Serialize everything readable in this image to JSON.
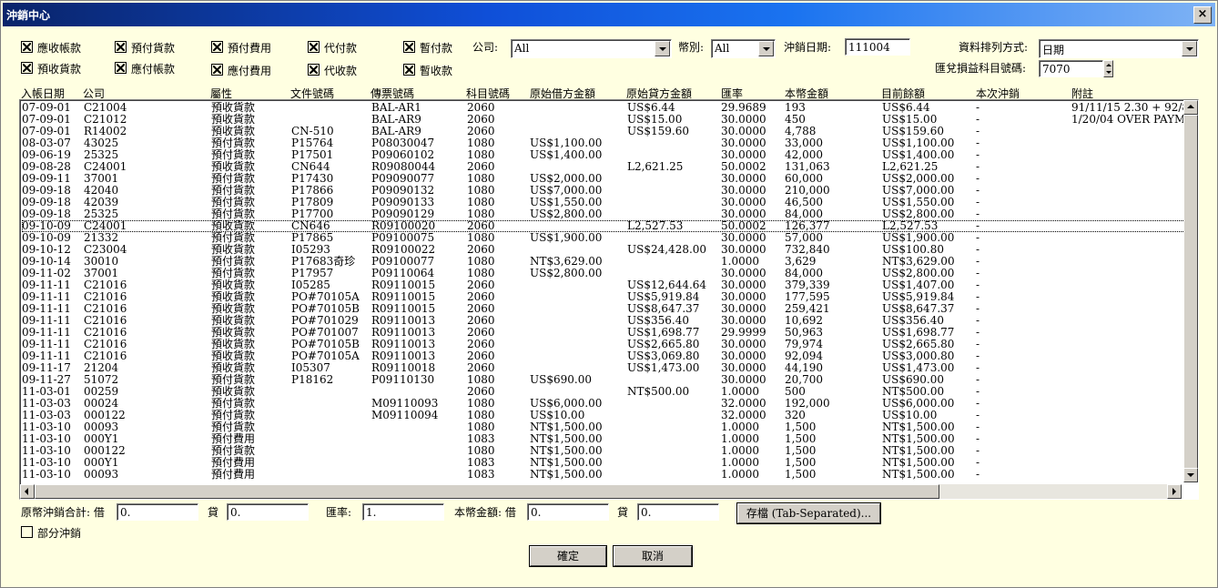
{
  "window": {
    "title": "沖銷中心",
    "close_label": "×"
  },
  "filters": {
    "checkboxes": [
      {
        "label": "應收帳款",
        "checked": true
      },
      {
        "label": "預付貨款",
        "checked": true
      },
      {
        "label": "預付費用",
        "checked": true
      },
      {
        "label": "代付款",
        "checked": true
      },
      {
        "label": "暫付款",
        "checked": true
      },
      {
        "label": "預收貨款",
        "checked": true
      },
      {
        "label": "應付帳款",
        "checked": true
      },
      {
        "label": "應付費用",
        "checked": true
      },
      {
        "label": "代收款",
        "checked": true
      },
      {
        "label": "暫收款",
        "checked": true
      }
    ],
    "company_label": "公司:",
    "company_value": "All",
    "currency_label": "幣別:",
    "currency_value": "All",
    "date_label": "沖銷日期:",
    "date_value": "111004",
    "sort_label": "資料排列方式:",
    "sort_value": "日期",
    "fx_account_label": "匯兌損益科目號碼:",
    "fx_account_value": "7070"
  },
  "table": {
    "columns": [
      "入帳日期",
      "公司",
      "屬性",
      "文件號碼",
      "傳票號碼",
      "科目號碼",
      "原始借方金額",
      "原始貸方金額",
      "匯率",
      "本幣金額",
      "目前餘額",
      "本次沖銷",
      "附註"
    ],
    "rows": [
      [
        "07-09-01",
        "C21004",
        "預收貨款",
        "",
        "BAL-AR1",
        "2060",
        "",
        "US$6.44",
        "29.9689",
        "193",
        "US$6.44",
        "-",
        "91/11/15 2.30 + 92/8/20 C"
      ],
      [
        "07-09-01",
        "C21012",
        "預收貨款",
        "",
        "BAL-AR9",
        "2060",
        "",
        "US$15.00",
        "30.0000",
        "450",
        "US$15.00",
        "-",
        "1/20/04 OVER PAYMEN"
      ],
      [
        "07-09-01",
        "R14002",
        "預收貨款",
        "CN-510",
        "BAL-AR9",
        "2060",
        "",
        "US$159.60",
        "30.0000",
        "4,788",
        "US$159.60",
        "-",
        ""
      ],
      [
        "08-03-07",
        "43025",
        "預付貨款",
        "P15764",
        "P08030047",
        "1080",
        "US$1,100.00",
        "",
        "30.0000",
        "33,000",
        "US$1,100.00",
        "-",
        ""
      ],
      [
        "09-06-19",
        "25325",
        "預付貨款",
        "P17501",
        "P09060102",
        "1080",
        "US$1,400.00",
        "",
        "30.0000",
        "42,000",
        "US$1,400.00",
        "-",
        ""
      ],
      [
        "09-08-28",
        "C24001",
        "預收貨款",
        "CN644",
        "R09080044",
        "2060",
        "",
        "L2,621.25",
        "50.0002",
        "131,063",
        "L2,621.25",
        "-",
        ""
      ],
      [
        "09-09-11",
        "37001",
        "預付貨款",
        "P17430",
        "P09090077",
        "1080",
        "US$2,000.00",
        "",
        "30.0000",
        "60,000",
        "US$2,000.00",
        "-",
        ""
      ],
      [
        "09-09-18",
        "42040",
        "預付貨款",
        "P17866",
        "P09090132",
        "1080",
        "US$7,000.00",
        "",
        "30.0000",
        "210,000",
        "US$7,000.00",
        "-",
        ""
      ],
      [
        "09-09-18",
        "42039",
        "預付貨款",
        "P17809",
        "P09090133",
        "1080",
        "US$1,550.00",
        "",
        "30.0000",
        "46,500",
        "US$1,550.00",
        "-",
        ""
      ],
      [
        "09-09-18",
        "25325",
        "預付貨款",
        "P17700",
        "P09090129",
        "1080",
        "US$2,800.00",
        "",
        "30.0000",
        "84,000",
        "US$2,800.00",
        "-",
        ""
      ],
      [
        "09-10-09",
        "C24001",
        "預收貨款",
        "CN646",
        "R09100020",
        "2060",
        "",
        "L2,527.53",
        "50.0002",
        "126,377",
        "L2,527.53",
        "-",
        ""
      ],
      [
        "09-10-09",
        "21332",
        "預付貨款",
        "P17865",
        "P09100075",
        "1080",
        "US$1,900.00",
        "",
        "30.0000",
        "57,000",
        "US$1,900.00",
        "-",
        ""
      ],
      [
        "09-10-12",
        "C23004",
        "預收貨款",
        "I05293",
        "R09100022",
        "2060",
        "",
        "US$24,428.00",
        "30.0000",
        "732,840",
        "US$100.80",
        "-",
        ""
      ],
      [
        "09-10-14",
        "30010",
        "預付貨款",
        "P17683奇珍",
        "P09100077",
        "1080",
        "NT$3,629.00",
        "",
        "1.0000",
        "3,629",
        "NT$3,629.00",
        "-",
        ""
      ],
      [
        "09-11-02",
        "37001",
        "預付貨款",
        "P17957",
        "P09110064",
        "1080",
        "US$2,800.00",
        "",
        "30.0000",
        "84,000",
        "US$2,800.00",
        "-",
        ""
      ],
      [
        "09-11-11",
        "C21016",
        "預收貨款",
        "I05285",
        "R09110015",
        "2060",
        "",
        "US$12,644.64",
        "30.0000",
        "379,339",
        "US$1,407.00",
        "-",
        ""
      ],
      [
        "09-11-11",
        "C21016",
        "預收貨款",
        "PO#70105A",
        "R09110015",
        "2060",
        "",
        "US$5,919.84",
        "30.0000",
        "177,595",
        "US$5,919.84",
        "-",
        ""
      ],
      [
        "09-11-11",
        "C21016",
        "預收貨款",
        "PO#70105B",
        "R09110015",
        "2060",
        "",
        "US$8,647.37",
        "30.0000",
        "259,421",
        "US$8,647.37",
        "-",
        ""
      ],
      [
        "09-11-11",
        "C21016",
        "預收貨款",
        "PO#701029",
        "R09110013",
        "2060",
        "",
        "US$356.40",
        "30.0000",
        "10,692",
        "US$356.40",
        "-",
        ""
      ],
      [
        "09-11-11",
        "C21016",
        "預收貨款",
        "PO#701007",
        "R09110013",
        "2060",
        "",
        "US$1,698.77",
        "29.9999",
        "50,963",
        "US$1,698.77",
        "-",
        ""
      ],
      [
        "09-11-11",
        "C21016",
        "預收貨款",
        "PO#70105B",
        "R09110013",
        "2060",
        "",
        "US$2,665.80",
        "30.0000",
        "79,974",
        "US$2,665.80",
        "-",
        ""
      ],
      [
        "09-11-11",
        "C21016",
        "預收貨款",
        "PO#70105A",
        "R09110013",
        "2060",
        "",
        "US$3,069.80",
        "30.0000",
        "92,094",
        "US$3,000.80",
        "-",
        ""
      ],
      [
        "09-11-17",
        "21204",
        "預收貨款",
        "I05307",
        "R09110018",
        "2060",
        "",
        "US$1,473.00",
        "30.0000",
        "44,190",
        "US$1,473.00",
        "-",
        ""
      ],
      [
        "09-11-27",
        "51072",
        "預付貨款",
        "P18162",
        "P09110130",
        "1080",
        "US$690.00",
        "",
        "30.0000",
        "20,700",
        "US$690.00",
        "-",
        ""
      ],
      [
        "11-03-01",
        "00259",
        "預收貨款",
        "",
        "",
        "2060",
        "",
        "NT$500.00",
        "1.0000",
        "500",
        "NT$500.00",
        "-",
        ""
      ],
      [
        "11-03-03",
        "00024",
        "預付貨款",
        "",
        "M09110093",
        "1080",
        "US$6,000.00",
        "",
        "32.0000",
        "192,000",
        "US$6,000.00",
        "-",
        ""
      ],
      [
        "11-03-03",
        "000122",
        "預付貨款",
        "",
        "M09110094",
        "1080",
        "US$10.00",
        "",
        "32.0000",
        "320",
        "US$10.00",
        "-",
        ""
      ],
      [
        "11-03-10",
        "00093",
        "預付貨款",
        "",
        "",
        "1080",
        "NT$1,500.00",
        "",
        "1.0000",
        "1,500",
        "NT$1,500.00",
        "-",
        ""
      ],
      [
        "11-03-10",
        "000Y1",
        "預付費用",
        "",
        "",
        "1083",
        "NT$1,500.00",
        "",
        "1.0000",
        "1,500",
        "NT$1,500.00",
        "-",
        ""
      ],
      [
        "11-03-10",
        "000122",
        "預付貨款",
        "",
        "",
        "1080",
        "NT$1,500.00",
        "",
        "1.0000",
        "1,500",
        "NT$1,500.00",
        "-",
        ""
      ],
      [
        "11-03-10",
        "000Y1",
        "預付費用",
        "",
        "",
        "1083",
        "NT$1,500.00",
        "",
        "1.0000",
        "1,500",
        "NT$1,500.00",
        "-",
        ""
      ],
      [
        "11-03-10",
        "00093",
        "預付費用",
        "",
        "",
        "1083",
        "NT$1,500.00",
        "",
        "1.0000",
        "1,500",
        "NT$1,500.00",
        "-",
        ""
      ]
    ],
    "selected_row_index": 10
  },
  "totals": {
    "orig_label": "原幣沖銷合計: 借",
    "orig_debit": "0.",
    "credit_label": "貸",
    "orig_credit": "0.",
    "rate_label": "匯率:",
    "rate_value": "1.",
    "local_label": "本幣金額: 借",
    "local_debit": "0.",
    "local_credit_label": "貸",
    "local_credit": "0.",
    "save_button": "存檔 (Tab-Separated)..."
  },
  "partial": {
    "label": "部分沖銷",
    "checked": false
  },
  "actions": {
    "ok": "確定",
    "cancel": "取消"
  }
}
